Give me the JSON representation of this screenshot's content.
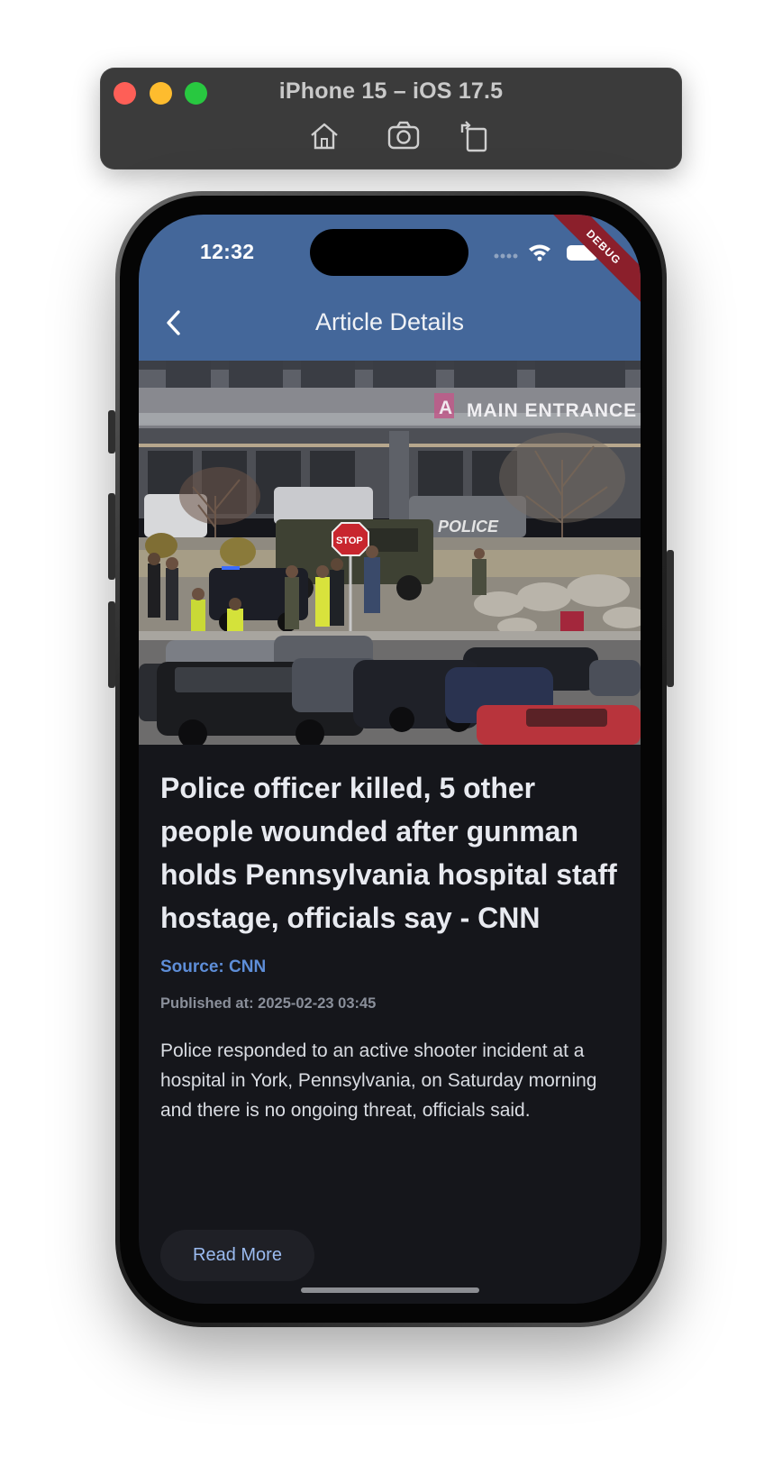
{
  "simulator": {
    "title": "iPhone 15 – iOS 17.5",
    "tools": [
      "home-icon",
      "screenshot-icon",
      "rotate-icon"
    ]
  },
  "status_bar": {
    "time": "12:32",
    "debug_label": "DEBUG"
  },
  "app_bar": {
    "title": "Article Details",
    "background": "#44679a"
  },
  "article": {
    "image_alt": "Police vehicles and officers outside a hospital main entrance",
    "sign_text": "MAIN ENTRANCE",
    "sign_letter": "A",
    "stop_text": "STOP",
    "police_text": "POLICE",
    "title": "Police officer killed, 5 other people wounded after gunman holds Pennsylvania hospital staff hostage, officials say - CNN",
    "source": "Source: CNN",
    "published": "Published at: 2025-02-23 03:45",
    "description": "Police responded to an active shooter incident at a hospital in York, Pennsylvania, on Saturday morning and there is no ongoing threat, officials said.",
    "read_more_label": "Read More"
  },
  "colors": {
    "background": "#15161b",
    "source": "#5e8ed8",
    "button_text": "#9bbbf0"
  }
}
